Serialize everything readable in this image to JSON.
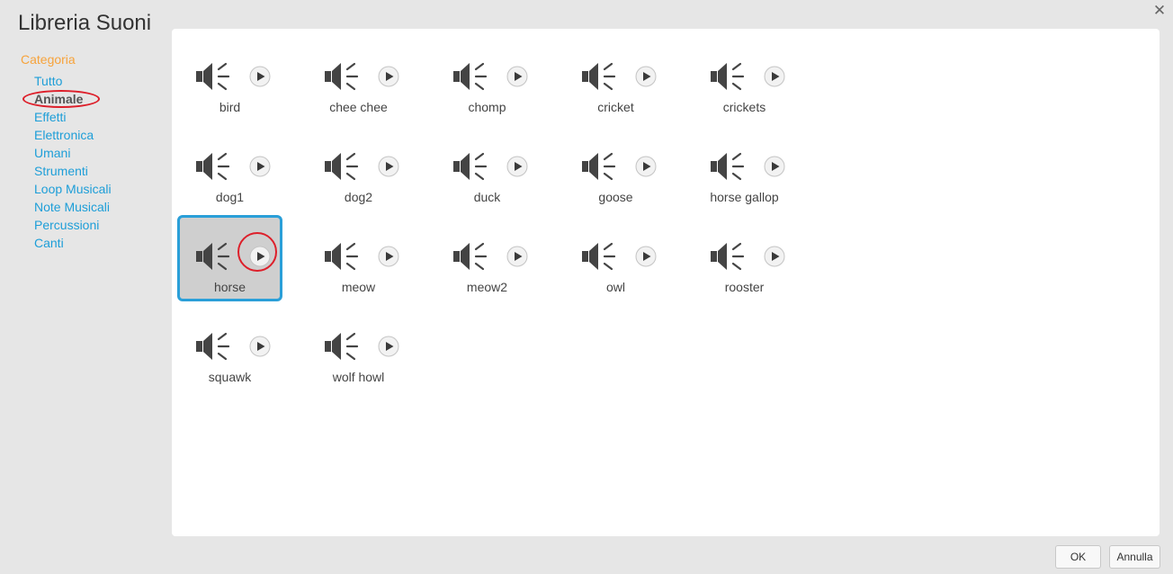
{
  "dialog": {
    "title": "Libreria Suoni",
    "close_icon": "close-icon"
  },
  "sidebar": {
    "heading": "Categoria",
    "items": [
      {
        "label": "Tutto"
      },
      {
        "label": "Animale",
        "selected": true
      },
      {
        "label": "Effetti"
      },
      {
        "label": "Elettronica"
      },
      {
        "label": "Umani"
      },
      {
        "label": "Strumenti"
      },
      {
        "label": "Loop Musicali"
      },
      {
        "label": "Note Musicali"
      },
      {
        "label": "Percussioni"
      },
      {
        "label": "Canti"
      }
    ]
  },
  "sounds": [
    {
      "name": "bird"
    },
    {
      "name": "chee chee"
    },
    {
      "name": "chomp"
    },
    {
      "name": "cricket"
    },
    {
      "name": "crickets"
    },
    {
      "name": "dog1"
    },
    {
      "name": "dog2"
    },
    {
      "name": "duck"
    },
    {
      "name": "goose"
    },
    {
      "name": "horse gallop"
    },
    {
      "name": "horse",
      "selected": true
    },
    {
      "name": "meow"
    },
    {
      "name": "meow2"
    },
    {
      "name": "owl"
    },
    {
      "name": "rooster"
    },
    {
      "name": "squawk"
    },
    {
      "name": "wolf howl"
    }
  ],
  "footer": {
    "ok_label": "OK",
    "cancel_label": "Annulla"
  },
  "colors": {
    "category_heading": "#f7a33b",
    "category_link": "#1d9ed8",
    "selection_border": "#2a9fd8",
    "annotation_red": "#dd1f2a"
  },
  "icons": {
    "sound": "speaker-icon",
    "play": "play-icon"
  }
}
